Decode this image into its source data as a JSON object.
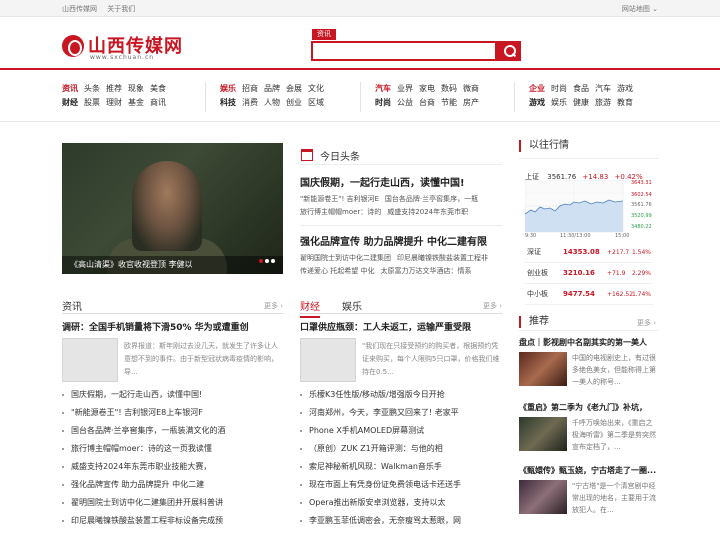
{
  "topbar": {
    "links": [
      "山西传媒网",
      "关于我们"
    ],
    "sitemap": "网站地图"
  },
  "logo": {
    "name": "山西传媒网",
    "url": "www.sxchuan.cn"
  },
  "search": {
    "tab": "资讯",
    "placeholder": ""
  },
  "nav": [
    {
      "rows": [
        [
          "资讯",
          "头条",
          "推荐",
          "现象",
          "美食"
        ],
        [
          "财经",
          "股票",
          "理财",
          "基金",
          "商讯"
        ]
      ]
    },
    {
      "rows": [
        [
          "娱乐",
          "招商",
          "品牌",
          "会展",
          "文化"
        ],
        [
          "科技",
          "消费",
          "人物",
          "创业",
          "区域"
        ]
      ]
    },
    {
      "rows": [
        [
          "汽车",
          "业界",
          "家电",
          "数码",
          "微商"
        ],
        [
          "时尚",
          "公益",
          "台商",
          "节能",
          "房产"
        ]
      ]
    },
    {
      "rows": [
        [
          "企业",
          "时尚",
          "食品",
          "汽车",
          "游戏"
        ],
        [
          "游戏",
          "娱乐",
          "健康",
          "旅游",
          "教育"
        ]
      ]
    }
  ],
  "hero": {
    "caption": "《高山清渠》收官收视登顶 李健以"
  },
  "today": {
    "title": "今日头条",
    "items": [
      {
        "headline": "国庆假期，一起行走山西，读懂中国!",
        "links": [
          [
            "\"新能源卷王\"! 吉利银河E",
            "国台各品牌·兰亭窖集序，一瓶"
          ],
          [
            "旅行博主帽帽moer：诗的",
            "威盛支持2024年东莞市职"
          ]
        ]
      },
      {
        "headline": "强化品牌宣传 助力品牌提升 中化二建有限",
        "links": [
          [
            "翟明国院士到访中化二建集团",
            "印尼晨曦镍铁酸盐装置工程非"
          ],
          [
            "传递爱心 托起希望 中化",
            "太原富力万达文华酒店：情系"
          ]
        ]
      }
    ]
  },
  "zixun": {
    "title": "资讯",
    "more": "更多",
    "top_title": "调研：全国手机销量将下滑50% 华为或遭重创",
    "summary": "欧界报道：斯年刚过去没几天，就发生了许多让人意想不到的事件。由于新型冠状病毒疫情的影响，导...",
    "list": [
      "国庆假期，一起行走山西，读懂中国!",
      "\"新能源卷王\"! 吉利银河E8上车银河F",
      "国台各品牌·兰亭窖集序，一瓶装满文化的酒",
      "旅行博主帽帽moer：诗的这一页我读懂",
      "威盛支持2024年东莞市职业技能大赛，",
      "强化品牌宣传 助力品牌提升 中化二建",
      "翟明国院士到访中化二建集团并开展科普讲",
      "印尼晨曦镍铁酸盐装置工程非标设备完成预"
    ]
  },
  "caijing": {
    "tabs": [
      "财经",
      "娱乐"
    ],
    "more": "更多",
    "top_title": "口罩供应瓶颈：工人未返工，运输严重受限",
    "summary": "\"我们现在只接受预约的购买者，根据预约凭证来购买，每个人限购5只口罩，价格我们维持在0.5...",
    "list": [
      "乐檬K3任性版/移动版/增强版今日开抢",
      "河南郑州，今天，李亚鹏又回来了! 老家平",
      "Phone X手机AMOLED屏幕测试",
      "（原创）ZUK Z1开箱评测：与他的相",
      "索尼神秘新机风现：Walkman音乐手",
      "现在市面上有凭身份证免费领电话卡还送手",
      "Opera推出新版安卓浏览器，支持以太",
      "李亚鹏玉菲低调密会，无奈瘦骂太惹眼，网"
    ]
  },
  "market": {
    "title": "以往行情",
    "label": "上证",
    "value": "3561.76",
    "change": "+14.83",
    "pct": "+0.42%",
    "axis_right": [
      "3643.31",
      "3602.54",
      "3561.76",
      "3520.99",
      "3480.22"
    ],
    "axis_bottom": [
      "9:30",
      "11:30/13:00",
      "15:00"
    ],
    "stocks": [
      {
        "name": "深证",
        "price": "14353.08",
        "change": "+217.7",
        "pct": "1.54%"
      },
      {
        "name": "创业板",
        "price": "3210.16",
        "change": "+71.9",
        "pct": "2.29%"
      },
      {
        "name": "中小板",
        "price": "9477.54",
        "change": "+162.52",
        "pct": "1.74%"
      }
    ]
  },
  "recommend": {
    "title": "推荐",
    "more": "更多",
    "items": [
      {
        "title": "盘点｜影视剧中名副其实的第一美人",
        "desc": "中国的电视剧史上，有过很多绝色美女，但能称得上第一美人的称号..."
      },
      {
        "title": "《重启》第二季为《老九门》补坑，",
        "desc": "千呼万唤始出来，《重启之极海听雷》第二季是剪突然宣布定档了，..."
      },
      {
        "title": "《甄嬛传》甄玉娆，宁古塔走了一圈...",
        "desc": "\"宁古塔\"是一个清宫剧中经常出现的地名，主要用于流放犯人。在..."
      }
    ]
  }
}
